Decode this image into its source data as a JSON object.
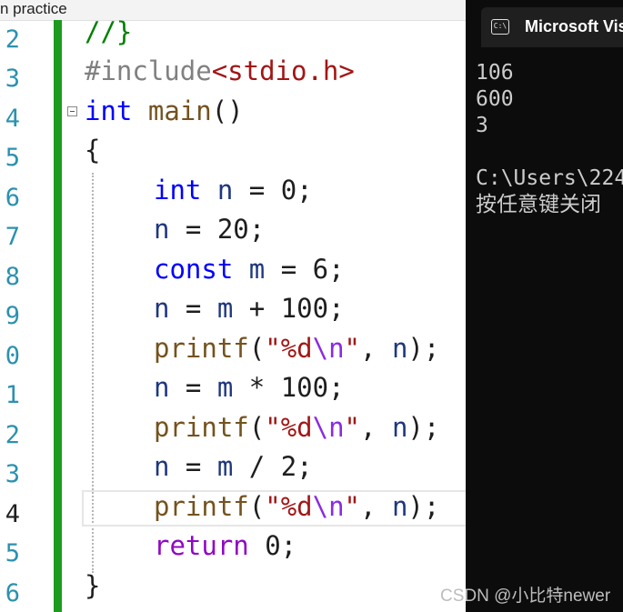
{
  "editor": {
    "title": "n practice",
    "line_numbers": [
      "2",
      "3",
      "4",
      "5",
      "6",
      "7",
      "8",
      "9",
      "0",
      "1",
      "2",
      "3",
      "4",
      "5",
      "6"
    ],
    "active_line_number": "4",
    "code": {
      "l1": "//}",
      "l2_directive": "#include",
      "l2_header": "<stdio.h>",
      "l3_kw": "int",
      "l3_fn": "main",
      "l3_rest": "()",
      "l4": "{",
      "l5_kw": "int",
      "l5_var": "n",
      "l5_rest": " = 0;",
      "l6_var": "n",
      "l6_rest": " = 20;",
      "l7_kw": "const",
      "l7_var": "m",
      "l7_rest": " = 6;",
      "l8_var1": "n",
      "l8_eq": " = ",
      "l8_var2": "m",
      "l8_rest": " + 100;",
      "l9_fn": "printf",
      "l9_open": "(",
      "l9_str1": "\"%d",
      "l9_esc": "\\n",
      "l9_str2": "\"",
      "l9_comma": ", ",
      "l9_var": "n",
      "l9_close": ");",
      "l10_var1": "n",
      "l10_eq": " = ",
      "l10_var2": "m",
      "l10_rest": " * 100;",
      "l11_fn": "printf",
      "l11_open": "(",
      "l11_str1": "\"%d",
      "l11_esc": "\\n",
      "l11_str2": "\"",
      "l11_comma": ", ",
      "l11_var": "n",
      "l11_close": ");",
      "l12_var1": "n",
      "l12_eq": " = ",
      "l12_var2": "m",
      "l12_rest": " / 2;",
      "l13_fn": "printf",
      "l13_open": "(",
      "l13_str1": "\"%d",
      "l13_esc": "\\n",
      "l13_str2": "\"",
      "l13_comma": ", ",
      "l13_var": "n",
      "l13_close": ");",
      "l14_kw": "return",
      "l14_rest": " 0;",
      "l15": "}"
    }
  },
  "console": {
    "tab_title": "Microsoft Vis",
    "tab_icon_text": "C:\\",
    "output": [
      "106",
      "600",
      "3",
      "",
      "C:\\Users\\224",
      "按任意键关闭"
    ]
  },
  "watermark": "CSDN @小比特newer",
  "colors": {
    "keyword": "#0000ff",
    "control": "#8f08c4",
    "string": "#a31515",
    "escape": "#8a2be2",
    "function": "#74531f",
    "variable": "#1f377f",
    "line_number": "#2b91af",
    "change_bar": "#1e9a1e",
    "console_bg": "#0c0c0c"
  }
}
